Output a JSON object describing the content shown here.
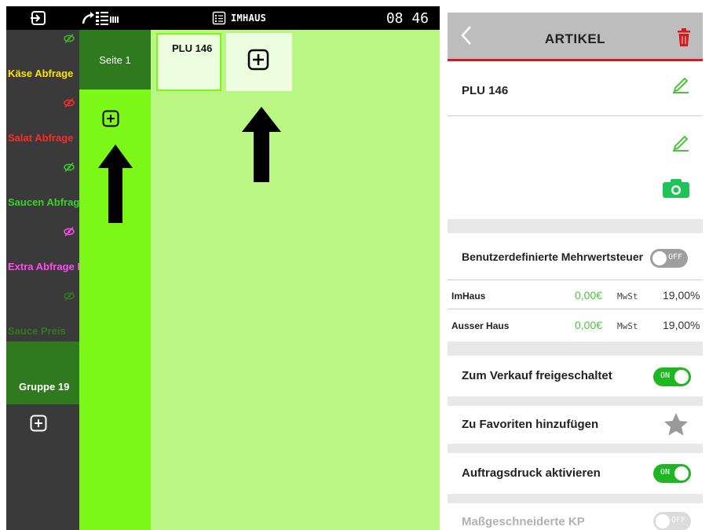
{
  "topbar": {
    "mode_label": "IMHAUS",
    "time": "08 46"
  },
  "groups": [
    {
      "label": "Käse Abfrage",
      "color": "#ffe100",
      "eye_color": "#3fb52a",
      "hidden": true
    },
    {
      "label": "Salat Abfrage",
      "color": "#ff2a2a",
      "eye_color": "#ff2a2a",
      "hidden": true
    },
    {
      "label": "Saucen Abfrage",
      "color": "#38d12a",
      "eye_color": "#38d12a",
      "hidden": true
    },
    {
      "label": "Extra Abfrage Kl",
      "color": "#ff4cf0",
      "eye_color": "#ff4cf0",
      "hidden": true
    },
    {
      "label": "Sauce Preis",
      "color": "#2f7a1f",
      "eye_color": "#2f7a1f",
      "hidden": true
    }
  ],
  "group_active": {
    "label": "Gruppe 19"
  },
  "page_active": {
    "label": "Seite 1"
  },
  "item": {
    "label": "PLU 146"
  },
  "panel": {
    "title": "ARTIKEL",
    "name_value": "PLU 146",
    "custom_vat_label": "Benutzerdefinierte Mehrwertsteuer",
    "custom_vat_toggle": "OFF",
    "imhaus": {
      "label": "ImHaus",
      "price": "0,00€",
      "mwst": "MwSt",
      "rate": "19,00%"
    },
    "ausserhaus": {
      "label": "Ausser Haus",
      "price": "0,00€",
      "mwst": "MwSt",
      "rate": "19,00%"
    },
    "sale_label": "Zum Verkauf freigeschaltet",
    "sale_toggle": "ON",
    "favorite_label": "Zu Favoriten hinzufügen",
    "print_label": "Auftragsdruck aktivieren",
    "print_toggle": "ON",
    "custom_kp_label": "Maßgeschneiderte KP",
    "custom_kp_toggle": "OFF"
  },
  "colors": {
    "accent_red": "#d8181d",
    "green_on": "#1fb523",
    "edit_green": "#4cc33a"
  }
}
